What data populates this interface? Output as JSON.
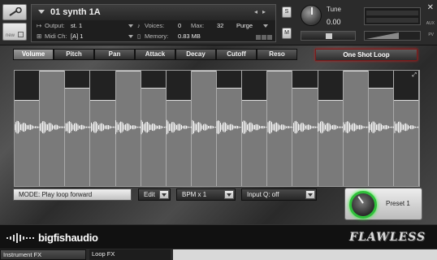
{
  "header": {
    "instrument_name": "01 synth 1A",
    "output_label": "Output:",
    "output_value": "st. 1",
    "voices_label": "Voices:",
    "voices_value": "0",
    "max_label": "Max:",
    "max_value": "32",
    "purge_label": "Purge",
    "midi_label": "Midi Ch:",
    "midi_value": "[A]  1",
    "memory_label": "Memory:",
    "memory_value": "0.83 MB",
    "solo_label": "S",
    "mute_label": "M",
    "tune_label": "Tune",
    "tune_value": "0.00",
    "aux_label": "AUX",
    "pv_label": "PV",
    "new_label": "new"
  },
  "tabs": [
    "Volume",
    "Pitch",
    "Pan",
    "Attack",
    "Decay",
    "Cutoff",
    "Reso"
  ],
  "active_tab": "Volume",
  "one_shot_label": "One Shot Loop",
  "step_levels": [
    0.75,
    1.0,
    0.85,
    0.75,
    1.0,
    0.85,
    0.75,
    1.0,
    0.85,
    0.75,
    1.0,
    0.85,
    0.75,
    1.0,
    0.85,
    0.75
  ],
  "controls": {
    "mode_label": "MODE: Play loop forward",
    "edit_label": "Edit",
    "bpm_label": "BPM x 1",
    "input_q_label": "Input Q: off",
    "preset_label": "Preset 1"
  },
  "footer": {
    "brand": "bigfishaudio",
    "product": "FLAWLESS"
  },
  "bottom_tabs": [
    "Instrument FX",
    "Loop FX"
  ],
  "colors": {
    "preset_ring": "#2fbf3a",
    "one_shot_glow": "#b22222",
    "active_tab": "#8a8a8a"
  }
}
